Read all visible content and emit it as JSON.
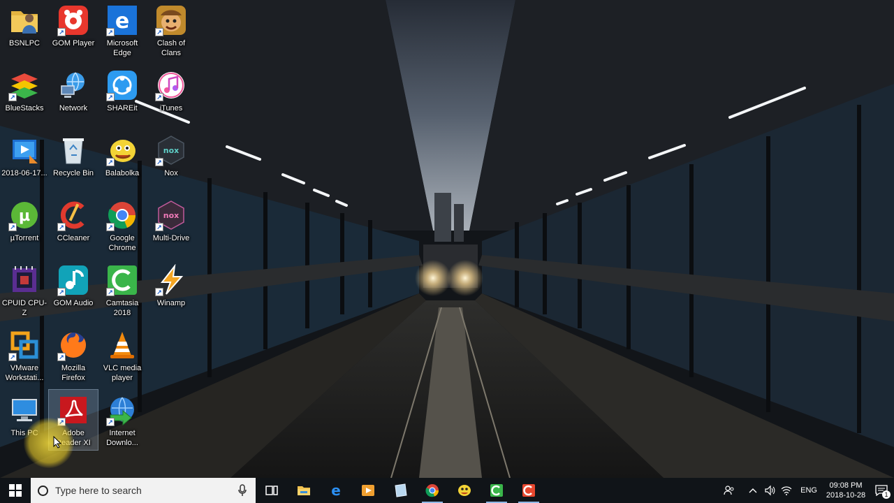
{
  "desktop": {
    "icons": [
      {
        "label": "BSNLPC",
        "icon": "user-folder-icon"
      },
      {
        "label": "GOM Player",
        "icon": "gom-player-icon"
      },
      {
        "label": "Microsoft Edge",
        "icon": "edge-icon"
      },
      {
        "label": "Clash of Clans",
        "icon": "clash-of-clans-icon"
      },
      {
        "label": "BlueStacks",
        "icon": "bluestacks-icon"
      },
      {
        "label": "Network",
        "icon": "network-icon"
      },
      {
        "label": "SHAREit",
        "icon": "shareit-icon"
      },
      {
        "label": "iTunes",
        "icon": "itunes-icon"
      },
      {
        "label": "2018-06-17...",
        "icon": "video-file-icon"
      },
      {
        "label": "Recycle Bin",
        "icon": "recycle-bin-icon"
      },
      {
        "label": "Balabolka",
        "icon": "balabolka-icon"
      },
      {
        "label": "Nox",
        "icon": "nox-icon"
      },
      {
        "label": "µTorrent",
        "icon": "utorrent-icon"
      },
      {
        "label": "CCleaner",
        "icon": "ccleaner-icon"
      },
      {
        "label": "Google Chrome",
        "icon": "chrome-icon"
      },
      {
        "label": "Multi-Drive",
        "icon": "nox-multi-drive-icon"
      },
      {
        "label": "CPUID CPU-Z",
        "icon": "cpu-z-icon"
      },
      {
        "label": "GOM Audio",
        "icon": "gom-audio-icon"
      },
      {
        "label": "Camtasia 2018",
        "icon": "camtasia-icon"
      },
      {
        "label": "Winamp",
        "icon": "winamp-icon"
      },
      {
        "label": "VMware Workstati...",
        "icon": "vmware-icon"
      },
      {
        "label": "Mozilla Firefox",
        "icon": "firefox-icon"
      },
      {
        "label": "VLC media player",
        "icon": "vlc-icon"
      },
      {
        "label": "This PC",
        "icon": "this-pc-icon"
      },
      {
        "label": "Adobe Reader XI",
        "icon": "adobe-reader-icon"
      },
      {
        "label": "Internet Downlo...",
        "icon": "internet-download-manager-icon"
      }
    ]
  },
  "taskbar": {
    "search_placeholder": "Type here to search",
    "pinned": [
      {
        "name": "task-view",
        "icon": "task-view-icon"
      },
      {
        "name": "file-explorer",
        "icon": "folder-icon"
      },
      {
        "name": "edge",
        "icon": "edge-icon"
      },
      {
        "name": "media-player",
        "icon": "media-player-icon"
      },
      {
        "name": "notes",
        "icon": "notes-icon"
      },
      {
        "name": "chrome",
        "icon": "chrome-icon"
      },
      {
        "name": "balabolka",
        "icon": "balabolka-icon"
      },
      {
        "name": "camtasia",
        "icon": "camtasia-icon"
      },
      {
        "name": "camtasia-recorder",
        "icon": "camtasia-recorder-icon"
      }
    ],
    "tray": {
      "language": "ENG",
      "time": "09:08 PM",
      "date": "2018-10-28",
      "notification_count": "1"
    }
  }
}
